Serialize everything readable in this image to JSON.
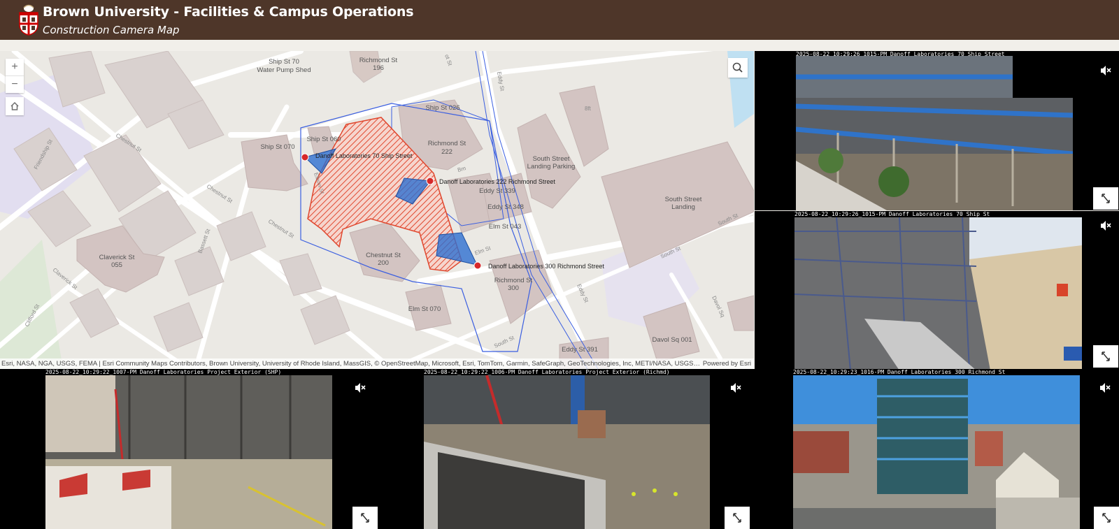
{
  "header": {
    "title": "Brown University - Facilities & Campus Operations",
    "subtitle": "Construction Camera Map",
    "colors": {
      "header_bg": "#4e3629",
      "text": "#ffffff"
    }
  },
  "map": {
    "icons": {
      "zoom_in": "plus-icon",
      "zoom_out": "minus-icon",
      "home": "home-icon",
      "search": "search-icon"
    },
    "zoom_in_label": "+",
    "zoom_out_label": "−",
    "camera_labels": [
      "Danoff Laboratories 70 Ship Street",
      "Danoff Laboratories 222 Richmond Street",
      "Danoff Laboratories 300 Richmond Street"
    ],
    "building_labels": {
      "ship70a": "Ship St 70",
      "ship70b": "Water Pump Shed",
      "rich196a": "Richmond St",
      "rich196b": "196",
      "ship026": "Ship St 026",
      "rich222a": "Richmond St",
      "rich222b": "222",
      "ship070": "Ship St 070",
      "ship060": "Ship St 060",
      "southpark1": "South Street",
      "southpark2": "Landing Parking",
      "eddy339": "Eddy St 339",
      "eddy348": "Eddy St 348",
      "elm043": "Elm St 043",
      "sslanding1": "South Street",
      "sslanding2": "Landing",
      "claverick1": "Claverick St",
      "claverick2": "055",
      "chest200a": "Chestnut St",
      "chest200b": "200",
      "rich300a": "Richmond St",
      "rich300b": "300",
      "elm070": "Elm St 070",
      "davsq": "Davol Sq 001",
      "eddy391": "Eddy St 391",
      "bldg8ft": "8ft"
    },
    "street_labels": {
      "chestnut1": "Chestnut St",
      "chestnut2": "Chestnut St",
      "chestnut3": "Chestnut St",
      "friendship": "Friendship St",
      "bassett": "Bassett St",
      "claverick": "Claverick St",
      "clifford": "Clifford St",
      "elbow": "Elbow St",
      "elm": "Elm St",
      "eddy1": "Eddy St",
      "eddy2": "Eddy St",
      "south1": "South St",
      "south2": "South St",
      "south3": "South St",
      "davol": "Davol Sq",
      "bm": "Bm",
      "ot": "ot St"
    },
    "attribution": "Esri, NASA, NGA, USGS, FEMA | Esri Community Maps Contributors, Brown University, University of Rhode Island, MassGIS, © OpenStreetMap, Microsoft, Esri, TomTom, Garmin, SafeGraph, GeoTechnologies, Inc, METI/NASA, USGS, EPA, NPS, US ...",
    "powered_by": "Powered by Esri",
    "colors": {
      "hatch": "#e0472e",
      "camera_cone": "#2e6fd1",
      "camera_point": "#d6282a",
      "outline": "#3b5fe0"
    }
  },
  "cameras": [
    {
      "timestamp": "2025-08-22_10:29:26_1015-PM Danoff Laboratories 70 Ship Street",
      "mute_icon": "muted-speaker-icon",
      "expand_icon": "expand-icon"
    },
    {
      "timestamp": "2025-08-22_10:29:26_1015-PM Danoff Laboratories 70 Ship St",
      "mute_icon": "muted-speaker-icon",
      "expand_icon": "expand-icon"
    },
    {
      "timestamp": "2025-08-22_10:29:22_1007-PM Danoff Laboratories Project Exterior (SHP)",
      "mute_icon": "muted-speaker-icon",
      "expand_icon": "expand-icon"
    },
    {
      "timestamp": "2025-08-22_10:29:22_1006-PM Danoff Laboratories Project Exterior (Richmd)",
      "mute_icon": "muted-speaker-icon",
      "expand_icon": "expand-icon"
    },
    {
      "timestamp": "2025-08-22_10:29:23_1016-PM Danoff Laboratories 300 Richmond St",
      "mute_icon": "muted-speaker-icon",
      "expand_icon": "expand-icon"
    }
  ]
}
